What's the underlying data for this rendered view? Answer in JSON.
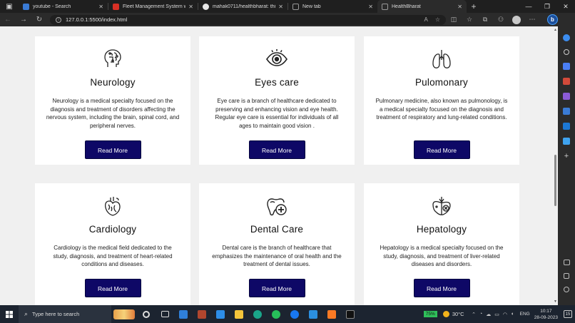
{
  "browser": {
    "tabs": [
      {
        "title": "youtube - Search",
        "color": "#3a7bd5",
        "active": false
      },
      {
        "title": "Fleet Management System with",
        "color": "#d93025",
        "active": false
      },
      {
        "title": "mahak0711/healthbharat: this is",
        "color": "#e6e6e6",
        "active": false
      },
      {
        "title": "New tab",
        "color": "#888888",
        "active": false
      },
      {
        "title": "HealthBharat",
        "color": "#888888",
        "active": true
      }
    ],
    "url": "127.0.0.1:5500/index.html"
  },
  "cards": [
    {
      "title": "Neurology",
      "icon": "brain-head-icon",
      "text": "Neurology is a medical specialty focused on the diagnosis and treatment of disorders affecting the nervous system, including the brain, spinal cord, and peripheral nerves.",
      "button": "Read More"
    },
    {
      "title": "Eyes care",
      "icon": "eye-icon",
      "text": "Eye care is a branch of healthcare dedicated to preserving and enhancing vision and eye health. Regular eye care is essential for individuals of all ages to maintain good vision .",
      "button": "Read More"
    },
    {
      "title": "Pulomonary",
      "icon": "lungs-icon",
      "text": "Pulmonary medicine, also known as pulmonology, is a medical specialty focused on the diagnosis and treatment of respiratory and lung-related conditions.",
      "button": "Read More"
    },
    {
      "title": "Cardiology",
      "icon": "heart-icon",
      "text": "Cardiology is the medical field dedicated to the study, diagnosis, and treatment of heart-related conditions and diseases.",
      "button": "Read More"
    },
    {
      "title": "Dental Care",
      "icon": "tooth-icon",
      "text": "Dental care is the branch of healthcare that emphasizes the maintenance of oral health and the treatment of dental issues.",
      "button": "Read More"
    },
    {
      "title": "Hepatology",
      "icon": "liver-icon",
      "text": "Hepatology is a medical specialty focused on the study, diagnosis, and treatment of liver-related diseases and disorders.",
      "button": "Read More"
    }
  ],
  "taskbar": {
    "search_placeholder": "Type here to search",
    "battery": "75%",
    "temperature": "30°C",
    "language": "ENG",
    "time": "10:17",
    "date": "28-09-2023",
    "notifications": "15"
  },
  "colors": {
    "button_bg": "#0e0866",
    "page_bg": "#f0f0f0",
    "card_bg": "#ffffff"
  }
}
